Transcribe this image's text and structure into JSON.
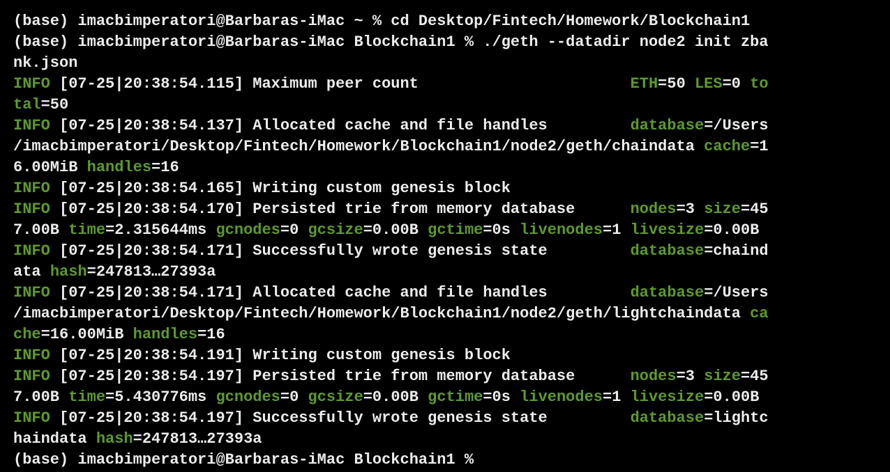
{
  "terminal": {
    "colors": {
      "background": "#000000",
      "text": "#ececec",
      "key_green": "#5d9a2e"
    },
    "lines": [
      [
        {
          "t": "(base) imacbimperatori@Barbaras-iMac ~ % cd Desktop/Fintech/Homework/Blockchain1",
          "c": "w"
        }
      ],
      [
        {
          "t": "(base) imacbimperatori@Barbaras-iMac Blockchain1 % ./geth --datadir node2 init zba",
          "c": "w"
        }
      ],
      [
        {
          "t": "nk.json",
          "c": "w"
        }
      ],
      [
        {
          "t": "INFO",
          "c": "g"
        },
        {
          "t": " [07-25|20:38:54.115] Maximum peer count                       ",
          "c": "w"
        },
        {
          "t": "ETH",
          "c": "g"
        },
        {
          "t": "=50 ",
          "c": "w"
        },
        {
          "t": "LES",
          "c": "g"
        },
        {
          "t": "=0 ",
          "c": "w"
        },
        {
          "t": "to",
          "c": "g"
        }
      ],
      [
        {
          "t": "tal",
          "c": "g"
        },
        {
          "t": "=50",
          "c": "w"
        }
      ],
      [
        {
          "t": "INFO",
          "c": "g"
        },
        {
          "t": " [07-25|20:38:54.137] Allocated cache and file handles         ",
          "c": "w"
        },
        {
          "t": "database",
          "c": "g"
        },
        {
          "t": "=/Users",
          "c": "w"
        }
      ],
      [
        {
          "t": "/imacbimperatori/Desktop/Fintech/Homework/Blockchain1/node2/geth/chaindata ",
          "c": "w"
        },
        {
          "t": "cache",
          "c": "g"
        },
        {
          "t": "=1",
          "c": "w"
        }
      ],
      [
        {
          "t": "6.00MiB ",
          "c": "w"
        },
        {
          "t": "handles",
          "c": "g"
        },
        {
          "t": "=16",
          "c": "w"
        }
      ],
      [
        {
          "t": "INFO",
          "c": "g"
        },
        {
          "t": " [07-25|20:38:54.165] Writing custom genesis block",
          "c": "w"
        }
      ],
      [
        {
          "t": "INFO",
          "c": "g"
        },
        {
          "t": " [07-25|20:38:54.170] Persisted trie from memory database      ",
          "c": "w"
        },
        {
          "t": "nodes",
          "c": "g"
        },
        {
          "t": "=3 ",
          "c": "w"
        },
        {
          "t": "size",
          "c": "g"
        },
        {
          "t": "=45",
          "c": "w"
        }
      ],
      [
        {
          "t": "7.00B ",
          "c": "w"
        },
        {
          "t": "time",
          "c": "g"
        },
        {
          "t": "=2.315644ms ",
          "c": "w"
        },
        {
          "t": "gcnodes",
          "c": "g"
        },
        {
          "t": "=0 ",
          "c": "w"
        },
        {
          "t": "gcsize",
          "c": "g"
        },
        {
          "t": "=0.00B ",
          "c": "w"
        },
        {
          "t": "gctime",
          "c": "g"
        },
        {
          "t": "=0s ",
          "c": "w"
        },
        {
          "t": "livenodes",
          "c": "g"
        },
        {
          "t": "=1 ",
          "c": "w"
        },
        {
          "t": "livesize",
          "c": "g"
        },
        {
          "t": "=0.00B",
          "c": "w"
        }
      ],
      [
        {
          "t": "INFO",
          "c": "g"
        },
        {
          "t": " [07-25|20:38:54.171] Successfully wrote genesis state         ",
          "c": "w"
        },
        {
          "t": "database",
          "c": "g"
        },
        {
          "t": "=chaind",
          "c": "w"
        }
      ],
      [
        {
          "t": "ata ",
          "c": "w"
        },
        {
          "t": "hash",
          "c": "g"
        },
        {
          "t": "=247813…27393a",
          "c": "w"
        }
      ],
      [
        {
          "t": "INFO",
          "c": "g"
        },
        {
          "t": " [07-25|20:38:54.171] Allocated cache and file handles         ",
          "c": "w"
        },
        {
          "t": "database",
          "c": "g"
        },
        {
          "t": "=/Users",
          "c": "w"
        }
      ],
      [
        {
          "t": "/imacbimperatori/Desktop/Fintech/Homework/Blockchain1/node2/geth/lightchaindata ",
          "c": "w"
        },
        {
          "t": "ca",
          "c": "g"
        }
      ],
      [
        {
          "t": "che",
          "c": "g"
        },
        {
          "t": "=16.00MiB ",
          "c": "w"
        },
        {
          "t": "handles",
          "c": "g"
        },
        {
          "t": "=16",
          "c": "w"
        }
      ],
      [
        {
          "t": "INFO",
          "c": "g"
        },
        {
          "t": " [07-25|20:38:54.191] Writing custom genesis block",
          "c": "w"
        }
      ],
      [
        {
          "t": "INFO",
          "c": "g"
        },
        {
          "t": " [07-25|20:38:54.197] Persisted trie from memory database      ",
          "c": "w"
        },
        {
          "t": "nodes",
          "c": "g"
        },
        {
          "t": "=3 ",
          "c": "w"
        },
        {
          "t": "size",
          "c": "g"
        },
        {
          "t": "=45",
          "c": "w"
        }
      ],
      [
        {
          "t": "7.00B ",
          "c": "w"
        },
        {
          "t": "time",
          "c": "g"
        },
        {
          "t": "=5.430776ms ",
          "c": "w"
        },
        {
          "t": "gcnodes",
          "c": "g"
        },
        {
          "t": "=0 ",
          "c": "w"
        },
        {
          "t": "gcsize",
          "c": "g"
        },
        {
          "t": "=0.00B ",
          "c": "w"
        },
        {
          "t": "gctime",
          "c": "g"
        },
        {
          "t": "=0s ",
          "c": "w"
        },
        {
          "t": "livenodes",
          "c": "g"
        },
        {
          "t": "=1 ",
          "c": "w"
        },
        {
          "t": "livesize",
          "c": "g"
        },
        {
          "t": "=0.00B",
          "c": "w"
        }
      ],
      [
        {
          "t": "INFO",
          "c": "g"
        },
        {
          "t": " [07-25|20:38:54.197] Successfully wrote genesis state         ",
          "c": "w"
        },
        {
          "t": "database",
          "c": "g"
        },
        {
          "t": "=lightc",
          "c": "w"
        }
      ],
      [
        {
          "t": "haindata ",
          "c": "w"
        },
        {
          "t": "hash",
          "c": "g"
        },
        {
          "t": "=247813…27393a",
          "c": "w"
        }
      ],
      [
        {
          "t": "(base) imacbimperatori@Barbaras-iMac Blockchain1 % ",
          "c": "w"
        }
      ]
    ]
  }
}
